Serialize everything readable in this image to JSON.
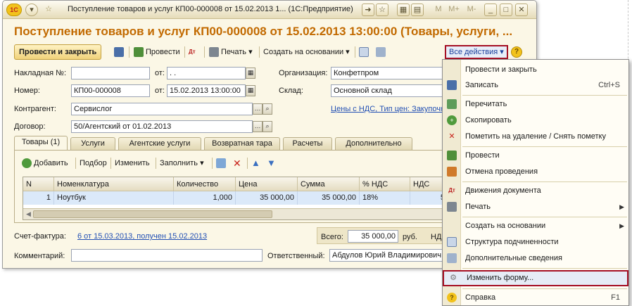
{
  "window": {
    "title": "Поступление товаров и услуг КП00-000008 от 15.02.2013 1...  (1С:Предприятие)",
    "logo": "1С",
    "buttons": [
      "M",
      "M+",
      "M-",
      "_",
      "□",
      "✕"
    ]
  },
  "document": {
    "heading": "Поступление товаров и услуг КП00-000008 от 15.02.2013 13:00:00 (Товары, услуги, ..."
  },
  "toolbar": {
    "post_close": "Провести и закрыть",
    "post": "Провести",
    "print": "Печать",
    "create_based": "Создать на основании",
    "all_actions": "Все действия",
    "help": "?"
  },
  "form": {
    "invoice_no_label": "Накладная №:",
    "invoice_no_value": "",
    "invoice_from_label": "от:",
    "invoice_from_value": " .  .",
    "org_label": "Организация:",
    "org_value": "Конфетпром",
    "number_label": "Номер:",
    "number_value": "КП00-000008",
    "date_label": "от:",
    "date_value": "15.02.2013 13:00:00",
    "warehouse_label": "Склад:",
    "warehouse_value": "Основной склад",
    "contractor_label": "Контрагент:",
    "contractor_value": "Сервислог",
    "prices_link": "Цены с НДС, Тип цен: Закупочная",
    "contract_label": "Договор:",
    "contract_value": "50/Агентский от 01.02.2013"
  },
  "tabs": [
    {
      "label": "Товары (1)"
    },
    {
      "label": "Услуги"
    },
    {
      "label": "Агентские услуги"
    },
    {
      "label": "Возвратная тара"
    },
    {
      "label": "Расчеты"
    },
    {
      "label": "Дополнительно"
    }
  ],
  "table_toolbar": {
    "add": "Добавить",
    "pick": "Подбор",
    "edit": "Изменить",
    "fill": "Заполнить"
  },
  "table": {
    "columns": [
      "N",
      "Номенклатура",
      "Количество",
      "Цена",
      "Сумма",
      "% НДС",
      "НДС"
    ],
    "rows": [
      [
        "1",
        "Ноутбук",
        "1,000",
        "35 000,00",
        "35 000,00",
        "18%",
        "5"
      ]
    ]
  },
  "footer": {
    "invoice_label": "Счет-фактура:",
    "invoice_link": "6 от 15.03.2013, получен 15.02.2013",
    "total_label": "Всего:",
    "total_value": "35 000,00",
    "currency": "руб.",
    "vat_label": "НД",
    "comment_label": "Комментарий:",
    "comment_value": "",
    "responsible_label": "Ответственный:",
    "responsible_value": "Абдулов Юрий Владимирович"
  },
  "menu": {
    "items": [
      {
        "label": "Провести и закрыть",
        "shortcut": "",
        "icon": "none"
      },
      {
        "label": "Записать",
        "shortcut": "Ctrl+S",
        "icon": "save-icon"
      },
      {
        "label": "Перечитать",
        "shortcut": "",
        "icon": "reload-icon"
      },
      {
        "label": "Скопировать",
        "shortcut": "",
        "icon": "copy-icon"
      },
      {
        "label": "Пометить на удаление / Снять пометку",
        "shortcut": "",
        "icon": "delete-mark-icon"
      },
      {
        "label": "Провести",
        "shortcut": "",
        "icon": "post-icon"
      },
      {
        "label": "Отмена проведения",
        "shortcut": "",
        "icon": "unpost-icon"
      },
      {
        "label": "Движения документа",
        "shortcut": "",
        "icon": "movements-icon"
      },
      {
        "label": "Печать",
        "shortcut": "",
        "icon": "print-icon"
      },
      {
        "label": "Создать на основании",
        "shortcut": "",
        "icon": "none"
      },
      {
        "label": "Структура подчиненности",
        "shortcut": "",
        "icon": "structure-icon"
      },
      {
        "label": "Дополнительные сведения",
        "shortcut": "",
        "icon": "info-icon"
      },
      {
        "label": "Изменить форму...",
        "shortcut": "",
        "icon": "gear-icon"
      },
      {
        "label": "Справка",
        "shortcut": "F1",
        "icon": "help-icon"
      }
    ]
  },
  "colors": {
    "heading": "#c26a00",
    "highlight_border": "#a50f23",
    "link": "#2350b4",
    "selected_row": "#dbe9f9"
  }
}
